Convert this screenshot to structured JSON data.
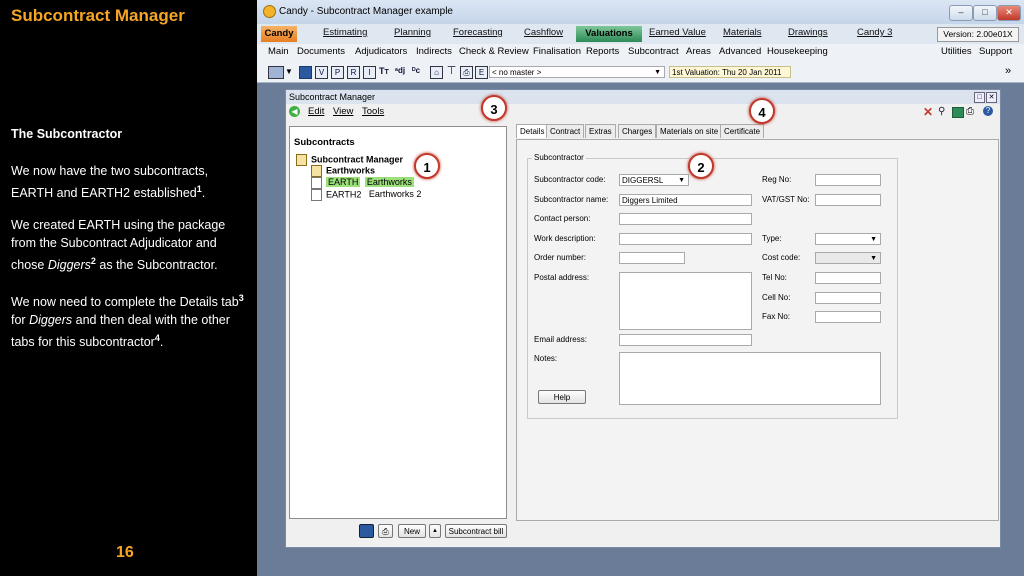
{
  "slide": {
    "title": "Subcontract Manager",
    "heading": "The Subcontractor",
    "para1": "We now have the two subcontracts, EARTH and EARTH2 established",
    "para1_sup": "1",
    "para1_end": ".",
    "para2_a": "We created EARTH using the package from the Subcontract Adjudicator and chose ",
    "para2_em": "Diggers",
    "para2_sup": "2",
    "para2_b": " as the Subcontractor.",
    "para3_a": "We now need to complete the Details tab",
    "para3_sup1": "3",
    "para3_b": " for ",
    "para3_em": "Diggers",
    "para3_c": " and then  deal with the other tabs for this subcontractor",
    "para3_sup2": "4",
    "para3_end": ".",
    "page_number": "16"
  },
  "window": {
    "title": "Candy - Subcontract Manager example",
    "version": "Version: 2.00e01X",
    "main_tabs": [
      "Candy",
      "Estimating",
      "Planning",
      "Forecasting",
      "Cashflow",
      "Valuations",
      "Earned Value",
      "Materials",
      "Drawings",
      "Candy 3"
    ],
    "active_tab": "Valuations",
    "menu_items": [
      "Main",
      "Documents",
      "Adjudicators",
      "Indirects",
      "Check & Review",
      "Finalisation",
      "Reports",
      "Subcontract",
      "Areas",
      "Advanced",
      "Housekeeping"
    ],
    "menu_right": [
      "Utilities",
      "Support"
    ],
    "toolbar": {
      "master_select": "< no master >",
      "valuation_label": "1st Valuation: Thu 20 Jan 2011"
    }
  },
  "dialog": {
    "title": "Subcontract Manager",
    "menu": [
      "Edit",
      "View",
      "Tools"
    ],
    "tree": {
      "header": "Subcontracts",
      "root": "Subcontract Manager",
      "group": "Earthworks",
      "items": [
        {
          "code": "EARTH",
          "name": "Earthworks"
        },
        {
          "code": "EARTH2",
          "name": "Earthworks 2"
        }
      ]
    },
    "bottom_buttons": {
      "new": "New",
      "bill": "Subcontract bill"
    },
    "tabs": [
      "Details",
      "Contract",
      "Extras",
      "Charges",
      "Materials on site",
      "Certificate"
    ],
    "active_tab": "Details",
    "group_title": "Subcontractor",
    "fields": {
      "code_label": "Subcontractor code:",
      "code_value": "DIGGERSL",
      "name_label": "Subcontractor name:",
      "name_value": "Diggers Limited",
      "contact_label": "Contact person:",
      "work_label": "Work description:",
      "order_label": "Order number:",
      "postal_label": "Postal address:",
      "email_label": "Email address:",
      "notes_label": "Notes:",
      "reg_label": "Reg No:",
      "vat_label": "VAT/GST No:",
      "type_label": "Type:",
      "cost_label": "Cost code:",
      "tel_label": "Tel No:",
      "cell_label": "Cell No:",
      "fax_label": "Fax No:"
    },
    "help_button": "Help"
  },
  "callouts": [
    "1",
    "2",
    "3",
    "4"
  ],
  "colors": {
    "accent": "#f5a623",
    "callout_border": "#c0392b",
    "active_tab": "#2e8b57"
  }
}
